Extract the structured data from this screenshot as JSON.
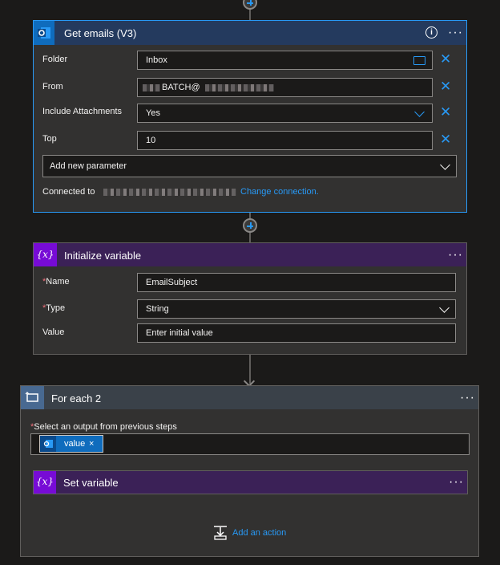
{
  "get_emails": {
    "title": "Get emails (V3)",
    "fields": [
      {
        "label": "Folder",
        "value": "Inbox"
      },
      {
        "label": "From",
        "value": "BATCH@"
      },
      {
        "label": "Include Attachments",
        "value": "Yes"
      },
      {
        "label": "Top",
        "value": "10"
      }
    ],
    "add_param": "Add new parameter",
    "connected_to": "Connected to",
    "change_connection": "Change connection."
  },
  "init_variable": {
    "title": "Initialize variable",
    "name_label": "Name",
    "name_value": "EmailSubject",
    "type_label": "Type",
    "type_value": "String",
    "value_label": "Value",
    "value_placeholder": "Enter initial value"
  },
  "for_each": {
    "title": "For each 2",
    "select_label": "Select an output from previous steps",
    "token": "value",
    "set_variable_title": "Set variable",
    "add_action": "Add an action"
  },
  "icons": {
    "menu": "more-dots-icon",
    "info": "info-icon",
    "outlook": "outlook-icon",
    "variable": "variable-icon",
    "loop": "loop-icon",
    "folder": "folder-icon",
    "add_action": "add-action-icon"
  },
  "colors": {
    "accent": "#2899f5",
    "outlook_header": "#243a5e",
    "variable": "#770bd6",
    "variable_header": "#3b2157",
    "loop_header": "#3a4149",
    "required": "#f1707b"
  }
}
